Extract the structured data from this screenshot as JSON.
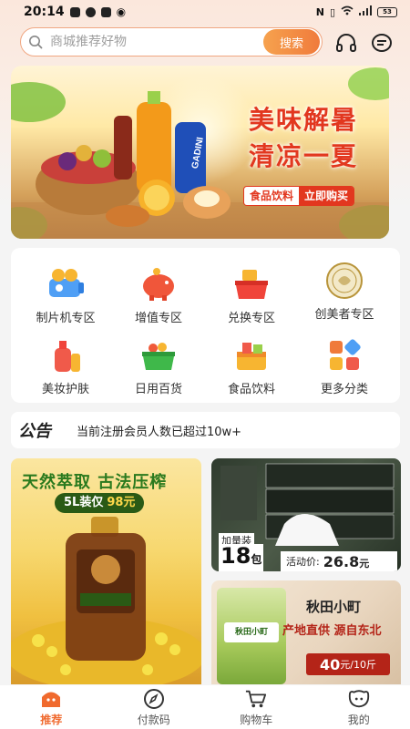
{
  "status_bar": {
    "time": "20:14",
    "battery": "53"
  },
  "search": {
    "placeholder": "商城推荐好物",
    "button_label": "搜索"
  },
  "header_icons": [
    "headset-icon",
    "message-icon"
  ],
  "banner": {
    "title_line1": "美味解暑",
    "title_line2": "清凉一夏",
    "tag": "食品饮料",
    "cta": "立即购买",
    "can_label": "GADINI"
  },
  "categories": [
    {
      "label": "制片机专区",
      "icon": "camera-machine-icon"
    },
    {
      "label": "增值专区",
      "icon": "piggy-bank-icon"
    },
    {
      "label": "兑换专区",
      "icon": "basket-icon"
    },
    {
      "label": "创美者专区",
      "icon": "medal-badge-icon"
    },
    {
      "label": "美妆护肤",
      "icon": "cosmetics-icon"
    },
    {
      "label": "日用百货",
      "icon": "shopping-basket-icon"
    },
    {
      "label": "食品饮料",
      "icon": "food-box-icon"
    },
    {
      "label": "更多分类",
      "icon": "grid-icon"
    }
  ],
  "notice": {
    "logo_text": "公告",
    "text": "当前注册会员人数已超过10w+"
  },
  "promo_oil": {
    "title": "天然萃取 古法压榨",
    "tag": "5L装仅",
    "price": "98元"
  },
  "promo_tissue": {
    "add_label": "加量装",
    "count": "18",
    "count_unit": "包",
    "price_label": "活动价:",
    "price": "26.8",
    "price_unit": "元"
  },
  "promo_rice": {
    "brand": "秋田小町",
    "slogan": "产地直供  源自东北",
    "price": "40",
    "price_unit": "元/10斤",
    "bag_label": "秋田小町"
  },
  "tabs": [
    {
      "label": "推荐",
      "icon": "home-face-icon",
      "active": true
    },
    {
      "label": "付款码",
      "icon": "compass-icon",
      "active": false
    },
    {
      "label": "购物车",
      "icon": "cart-icon",
      "active": false
    },
    {
      "label": "我的",
      "icon": "profile-icon",
      "active": false
    }
  ],
  "colors": {
    "accent": "#f07b3c",
    "banner_red": "#e2371f",
    "active_tab": "#f06a2e"
  }
}
